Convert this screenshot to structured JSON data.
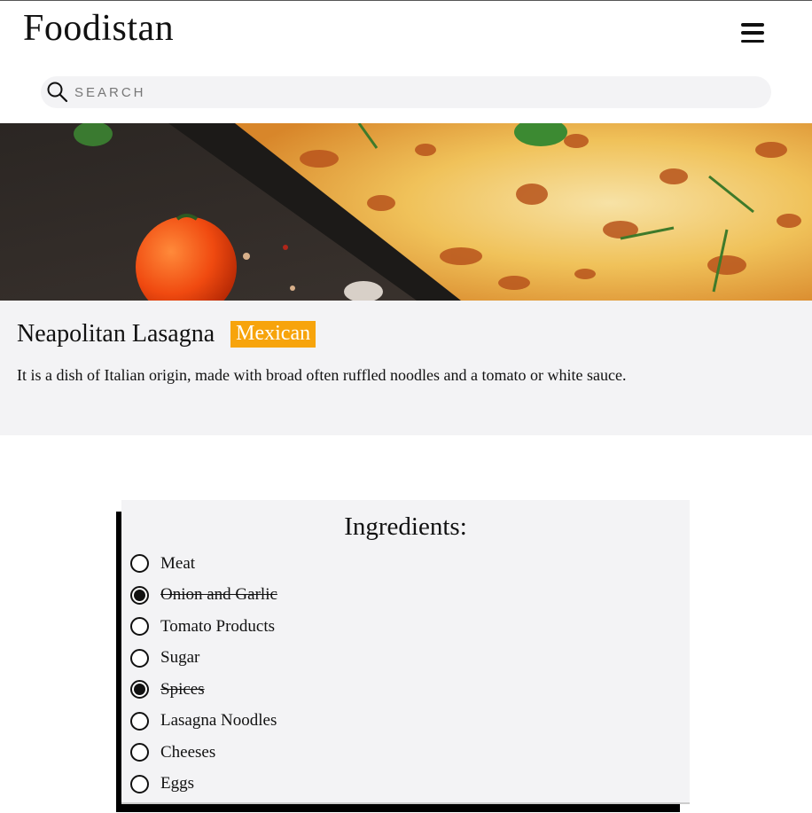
{
  "app": {
    "brand": "Foodistan"
  },
  "header": {
    "menu_icon": "hamburger-menu-icon"
  },
  "search": {
    "placeholder": "SEARCH",
    "icon": "search-icon"
  },
  "recipe": {
    "title": "Neapolitan Lasagna",
    "cuisine": "Mexican",
    "description": "It is a dish of Italian origin, made with broad often ruffled noodles and a tomato or white sauce.",
    "badge_color": "#f7a40c"
  },
  "ingredients": {
    "heading": "Ingredients:",
    "items": [
      {
        "label": "Meat",
        "checked": false
      },
      {
        "label": "Onion and Garlic",
        "checked": true
      },
      {
        "label": "Tomato Products",
        "checked": false
      },
      {
        "label": "Sugar",
        "checked": false
      },
      {
        "label": "Spices",
        "checked": true
      },
      {
        "label": "Lasagna Noodles",
        "checked": false
      },
      {
        "label": "Cheeses",
        "checked": false
      },
      {
        "label": "Eggs",
        "checked": false
      }
    ]
  }
}
